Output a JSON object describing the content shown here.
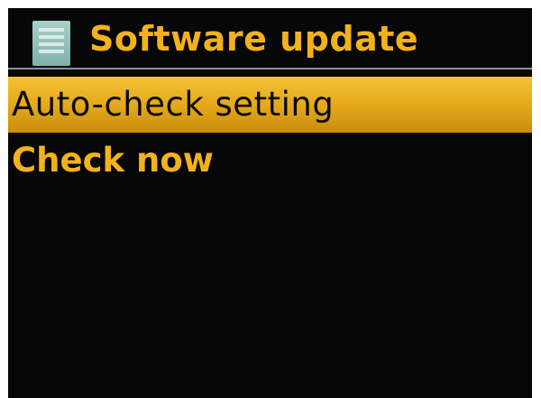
{
  "header": {
    "icon": "menu-list-icon",
    "title": "Software update"
  },
  "menu": {
    "items": [
      {
        "label": "Auto-check setting",
        "selected": true
      },
      {
        "label": "Check now",
        "selected": false
      }
    ]
  },
  "colors": {
    "background": "#070707",
    "accent": "#f2b21c",
    "selection": "#e5a91a",
    "selected_text": "#0c0a06"
  }
}
